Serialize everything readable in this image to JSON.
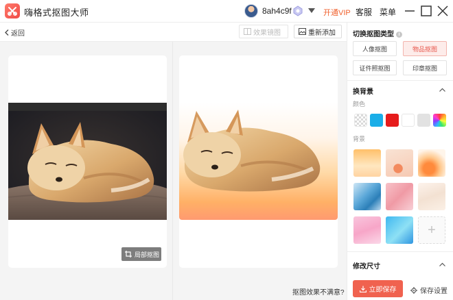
{
  "app": {
    "title": "嗨格式抠图大师"
  },
  "header": {
    "username": "8ah4c9f",
    "vip_label": "开通VIP",
    "service_label": "客服",
    "menu_label": "菜单"
  },
  "toolbar": {
    "back_label": "返回",
    "effect_compare_label": "效果镜图",
    "readd_label": "重新添加"
  },
  "canvas": {
    "local_cut_label": "局部抠图",
    "unsatisfied_label": "抠图效果不满意?"
  },
  "panel": {
    "cut_type_title": "切换抠图类型",
    "cut_types": [
      {
        "label": "人像抠图",
        "active": false
      },
      {
        "label": "物品抠图",
        "active": true
      },
      {
        "label": "证件照抠图",
        "active": false
      },
      {
        "label": "印章抠图",
        "active": false
      }
    ],
    "change_bg_title": "换背景",
    "color_label": "颜色",
    "colors": [
      "transparent",
      "#1aaee8",
      "#e61c1c",
      "#ffffff",
      "#e2e2e2",
      "rainbow"
    ],
    "background_label": "背景",
    "backgrounds": [
      "warm-gradient",
      "peach-illustration",
      "orange-glow",
      "blue-waves",
      "pink-marble",
      "cream-waves",
      "pink-clouds",
      "blue-gradient"
    ],
    "resize_title": "修改尺寸",
    "save_now_label": "立即保存",
    "save_settings_label": "保存设置"
  },
  "colors": {
    "accent": "#f0624f",
    "vip": "#f0622f"
  }
}
